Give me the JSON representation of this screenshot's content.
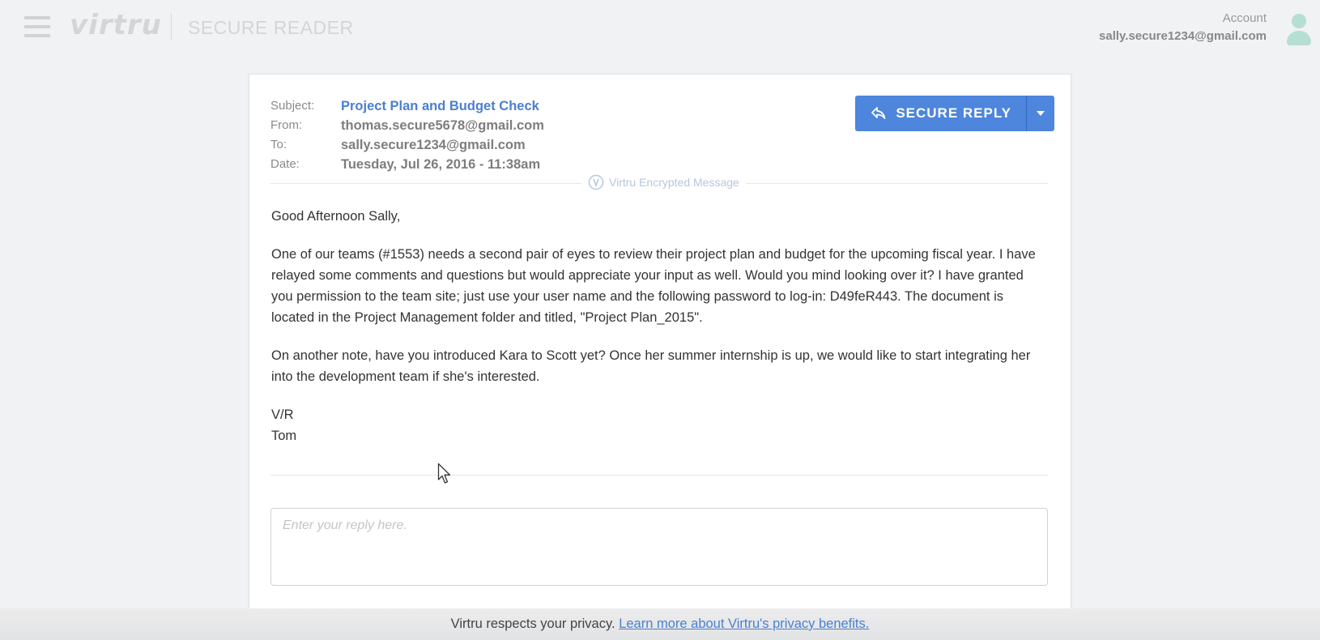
{
  "header": {
    "logo_text": "virtru",
    "app_title": "SECURE READER",
    "account_label": "Account",
    "account_email": "sally.secure1234@gmail.com"
  },
  "email": {
    "subject_label": "Subject:",
    "subject": "Project Plan and Budget Check",
    "from_label": "From:",
    "from": "thomas.secure5678@gmail.com",
    "to_label": "To:",
    "to": "sally.secure1234@gmail.com",
    "date_label": "Date:",
    "date": "Tuesday, Jul 26, 2016 - 11:38am",
    "encrypted_label": "Virtru Encrypted Message",
    "greeting": "Good Afternoon Sally,",
    "paragraph1": "One of our teams (#1553) needs a second pair of eyes to review their project plan and budget for the upcoming fiscal year. I have relayed some comments and questions but would appreciate your input as well. Would you mind looking over it? I have granted you permission to the team site; just use your user name and the following password to log-in: D49feR443. The document is located in the Project Management folder and titled, \"Project Plan_2015\".",
    "paragraph2": "On another note, have you introduced Kara to Scott yet? Once her summer internship is up, we would like to start integrating her into the development team if she's interested.",
    "signoff_line1": "V/R",
    "signoff_line2": "Tom"
  },
  "actions": {
    "secure_reply_label": "SECURE REPLY",
    "reply_placeholder": "Enter your reply here."
  },
  "footer": {
    "text": "Virtru respects your privacy.",
    "link": "Learn more about Virtru's privacy benefits."
  },
  "colors": {
    "accent": "#4d86dc",
    "subject": "#4a7fd1",
    "avatar": "#b6dfd3",
    "background": "#f1f2f3"
  },
  "icons": [
    "hamburger-menu-icon",
    "user-avatar-icon",
    "reply-icon",
    "caret-down-icon",
    "virtru-shield-icon",
    "mouse-pointer-icon"
  ]
}
